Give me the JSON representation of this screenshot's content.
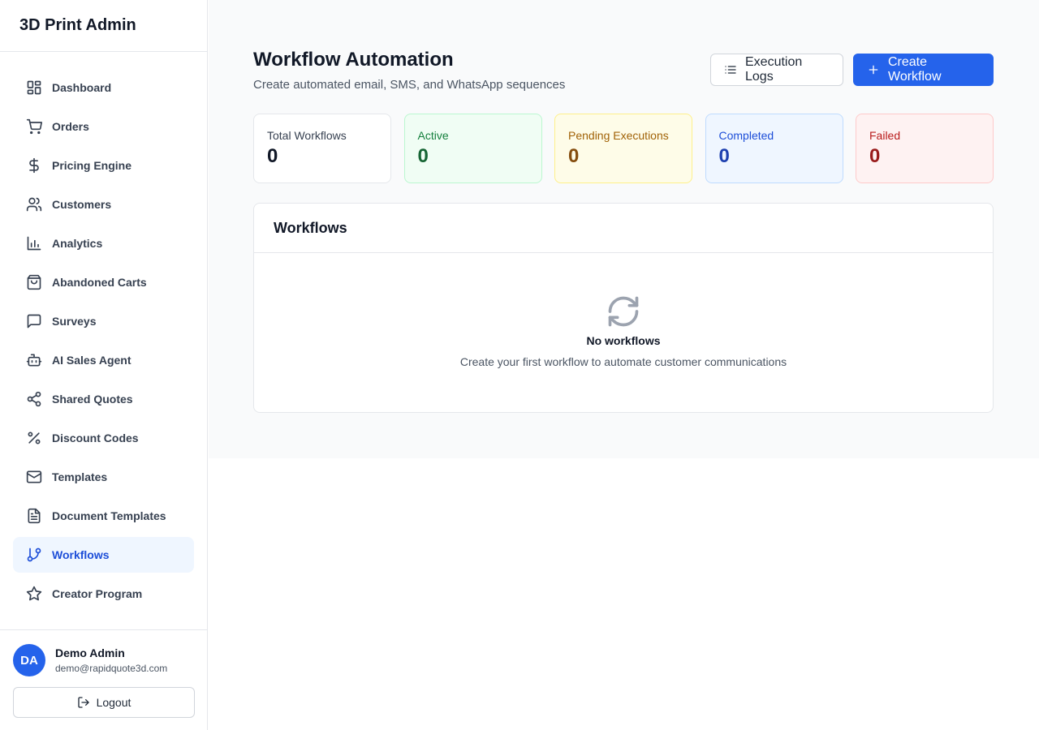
{
  "app": {
    "title": "3D Print Admin"
  },
  "sidebar": {
    "items": [
      {
        "label": "Dashboard",
        "icon": "dashboard-icon"
      },
      {
        "label": "Orders",
        "icon": "cart-icon"
      },
      {
        "label": "Pricing Engine",
        "icon": "dollar-icon"
      },
      {
        "label": "Customers",
        "icon": "users-icon"
      },
      {
        "label": "Analytics",
        "icon": "bar-chart-icon"
      },
      {
        "label": "Abandoned Carts",
        "icon": "shopping-bag-icon"
      },
      {
        "label": "Surveys",
        "icon": "message-square-icon"
      },
      {
        "label": "AI Sales Agent",
        "icon": "bot-icon"
      },
      {
        "label": "Shared Quotes",
        "icon": "share-icon"
      },
      {
        "label": "Discount Codes",
        "icon": "percent-icon"
      },
      {
        "label": "Templates",
        "icon": "mail-icon"
      },
      {
        "label": "Document Templates",
        "icon": "file-text-icon"
      },
      {
        "label": "Workflows",
        "icon": "git-branch-icon",
        "active": true
      },
      {
        "label": "Creator Program",
        "icon": "star-icon"
      }
    ]
  },
  "user": {
    "initials": "DA",
    "name": "Demo Admin",
    "email": "demo@rapidquote3d.com",
    "logout_label": "Logout"
  },
  "header": {
    "title": "Workflow Automation",
    "subtitle": "Create automated email, SMS, and WhatsApp sequences",
    "logs_button": "Execution Logs",
    "create_button": "Create Workflow"
  },
  "stats": {
    "total": {
      "label": "Total Workflows",
      "value": "0"
    },
    "active": {
      "label": "Active",
      "value": "0"
    },
    "pending": {
      "label": "Pending Executions",
      "value": "0"
    },
    "completed": {
      "label": "Completed",
      "value": "0"
    },
    "failed": {
      "label": "Failed",
      "value": "0"
    }
  },
  "panel": {
    "title": "Workflows",
    "empty_title": "No workflows",
    "empty_description": "Create your first workflow to automate customer communications"
  },
  "colors": {
    "primary": "#2563eb",
    "active_nav_bg": "#eff6ff",
    "active_nav_text": "#1d4ed8"
  }
}
